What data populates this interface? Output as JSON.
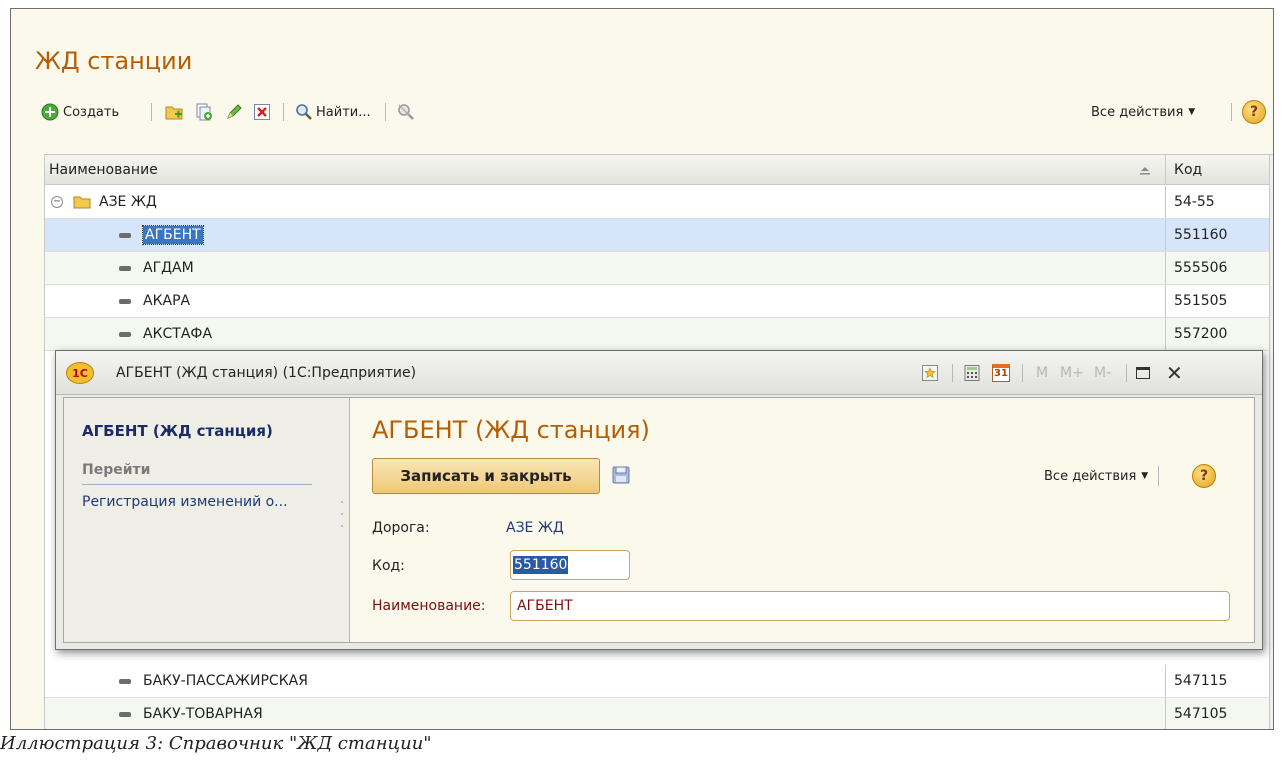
{
  "list_form": {
    "title": "ЖД станции",
    "toolbar": {
      "create_label": "Создать",
      "find_label": "Найти...",
      "all_actions_label": "Все действия",
      "help_label": "?"
    },
    "columns": {
      "name": "Наименование",
      "code": "Код"
    },
    "rows": [
      {
        "name": "АЗЕ ЖД",
        "code": "54-55",
        "type": "group"
      },
      {
        "name": "АГБЕНТ",
        "code": "551160",
        "type": "item",
        "selected": true
      },
      {
        "name": "АГДАМ",
        "code": "555506",
        "type": "item"
      },
      {
        "name": "АКАРА",
        "code": "551505",
        "type": "item"
      },
      {
        "name": "АКСТАФА",
        "code": "557200",
        "type": "item"
      },
      {
        "name": "БАКУ-ПАССАЖИРСКАЯ",
        "code": "547115",
        "type": "item"
      },
      {
        "name": "БАКУ-ТОВАРНАЯ",
        "code": "547105",
        "type": "item"
      }
    ]
  },
  "item_window": {
    "title": "АГБЕНТ (ЖД станция)  (1С:Предприятие)",
    "logo_text": "1С",
    "calc_buttons": {
      "m": "M",
      "m_plus": "M+",
      "m_minus": "M-"
    },
    "calendar_day": "31",
    "side": {
      "title": "АГБЕНТ (ЖД станция)",
      "goto_label": "Перейти",
      "link": "Регистрация изменений о..."
    },
    "form": {
      "title": "АГБЕНТ (ЖД станция)",
      "save_close_label": "Записать и закрыть",
      "all_actions_label": "Все действия",
      "help_label": "?",
      "road_label": "Дорога:",
      "road_value": "АЗЕ ЖД",
      "code_label": "Код:",
      "code_value": "551160",
      "name_label": "Наименование:",
      "name_value": "АГБЕНТ"
    }
  },
  "caption": "Иллюстрация 3: Справочник \"ЖД станции\"",
  "colors": {
    "title_orange": "#b45f06",
    "form_bg": "#fbf9ec",
    "selected_row": "#d6e5fa",
    "alt_row": "#f4f8f1",
    "button_gold": "#eec778",
    "link_blue": "#1c3a78",
    "name_value": "#7a1010"
  }
}
